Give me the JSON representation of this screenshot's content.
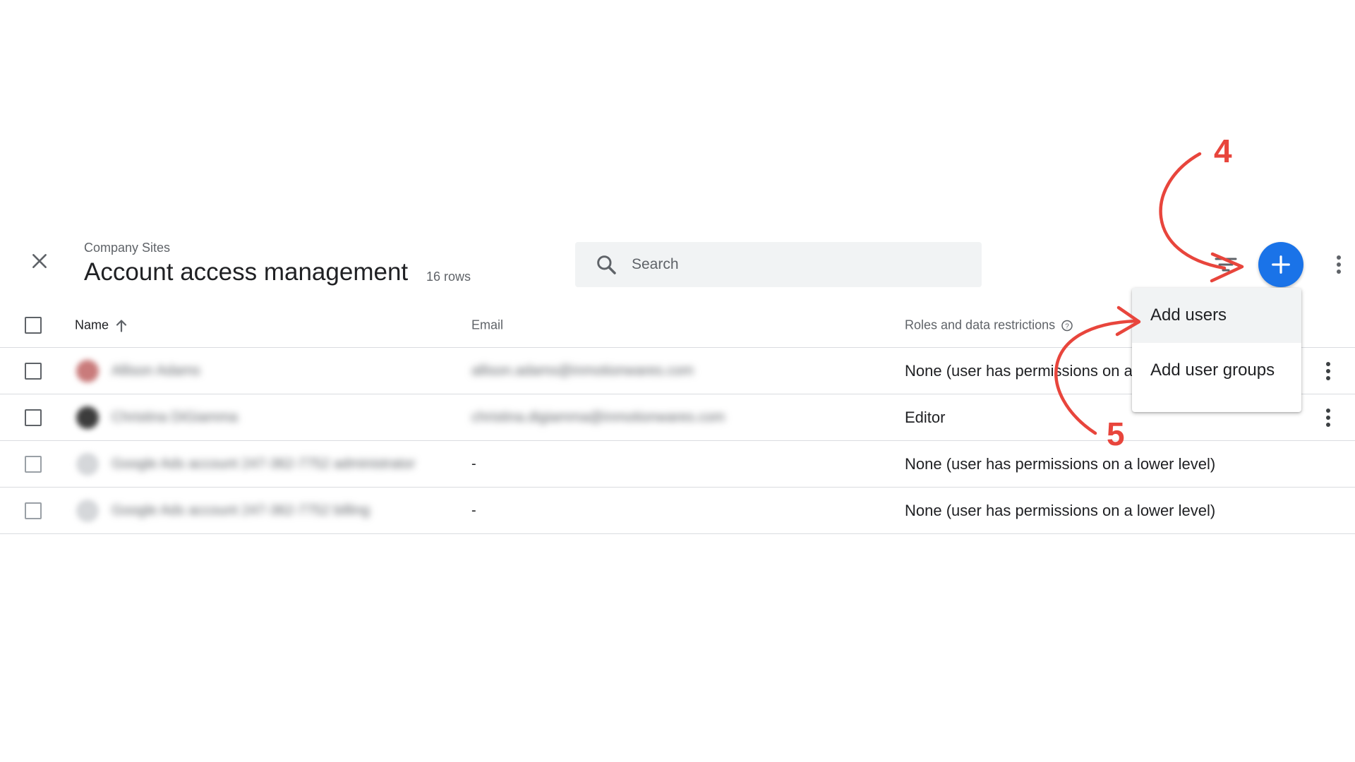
{
  "header": {
    "close_icon": "close-icon",
    "breadcrumb": "Company Sites",
    "title": "Account access management",
    "row_count": "16 rows"
  },
  "search": {
    "placeholder": "Search",
    "icon": "search-icon"
  },
  "toolbar": {
    "filter_icon": "filter-icon",
    "add_icon": "plus-icon",
    "more_icon": "more-vert-icon",
    "accent_color": "#1a73e8"
  },
  "table": {
    "columns": {
      "name": "Name",
      "email": "Email",
      "roles": "Roles and data restrictions"
    },
    "sort_icon": "arrow-up-icon",
    "help_icon": "help-circle-icon",
    "rows": [
      {
        "name": "Allison Adams",
        "email": "allison.adams@inmotionwares.com",
        "role": "None (user has permissions on a lower level)"
      },
      {
        "name": "Christina DiGiamma",
        "email": "christina.digiamma@inmotionwares.com",
        "role": "Editor"
      },
      {
        "name": "Google Ads account 247-362-7752 administrator",
        "email": "-",
        "role": "None (user has permissions on a lower level)"
      },
      {
        "name": "Google Ads account 247-362-7752 billing",
        "email": "-",
        "role": "None (user has permissions on a lower level)"
      }
    ]
  },
  "menu": {
    "items": [
      {
        "label": "Add users"
      },
      {
        "label": "Add user groups"
      }
    ]
  },
  "annotations": {
    "step_a": "4",
    "step_b": "5",
    "color": "#e8453c"
  }
}
